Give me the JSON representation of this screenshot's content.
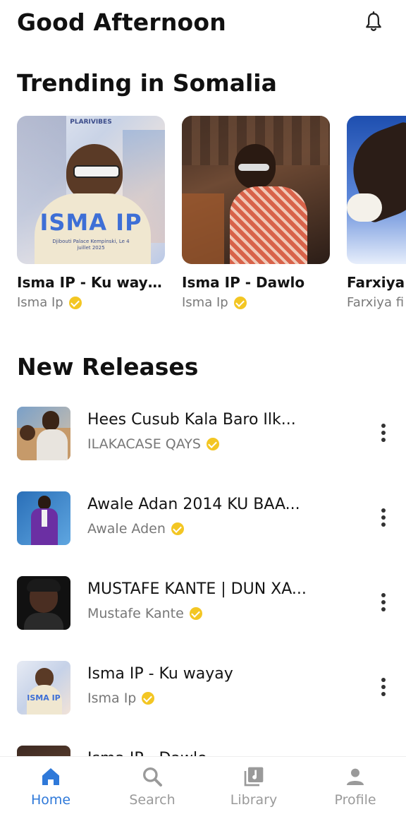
{
  "header": {
    "greeting": "Good Afternoon",
    "bell_icon": "bell-icon"
  },
  "trending": {
    "title": "Trending in Somalia",
    "items": [
      {
        "title": "Isma IP - Ku wayay",
        "artist": "Isma Ip",
        "cover_text": "ISMA IP",
        "cover_top": "PLARIVIBES",
        "cover_sub": "Djibouti Palace Kempinski, Le 4 juillet 2025"
      },
      {
        "title": "Isma IP - Dawlo",
        "artist": "Isma Ip"
      },
      {
        "title": "Farxiya",
        "artist": "Farxiya fi"
      }
    ]
  },
  "new_releases": {
    "title": "New Releases",
    "items": [
      {
        "title": "Hees Cusub Kala Baro Ilk...",
        "artist": "ILAKACASE QAYS"
      },
      {
        "title": "Awale Adan 2014 KU BAA...",
        "artist": "Awale Aden"
      },
      {
        "title": "MUSTAFE KANTE | DUN XA...",
        "artist": "Mustafe Kante"
      },
      {
        "title": "Isma IP - Ku wayay",
        "artist": "Isma Ip",
        "thumb_text": "ISMA IP"
      },
      {
        "title": "Isma IP - Dawlo",
        "artist": ""
      }
    ]
  },
  "tabbar": {
    "tabs": [
      {
        "label": "Home",
        "icon": "home-icon",
        "active": true
      },
      {
        "label": "Search",
        "icon": "search-icon"
      },
      {
        "label": "Library",
        "icon": "library-icon"
      },
      {
        "label": "Profile",
        "icon": "profile-icon"
      }
    ]
  },
  "colors": {
    "accent": "#2f79d9",
    "verified": "#f3c623"
  }
}
